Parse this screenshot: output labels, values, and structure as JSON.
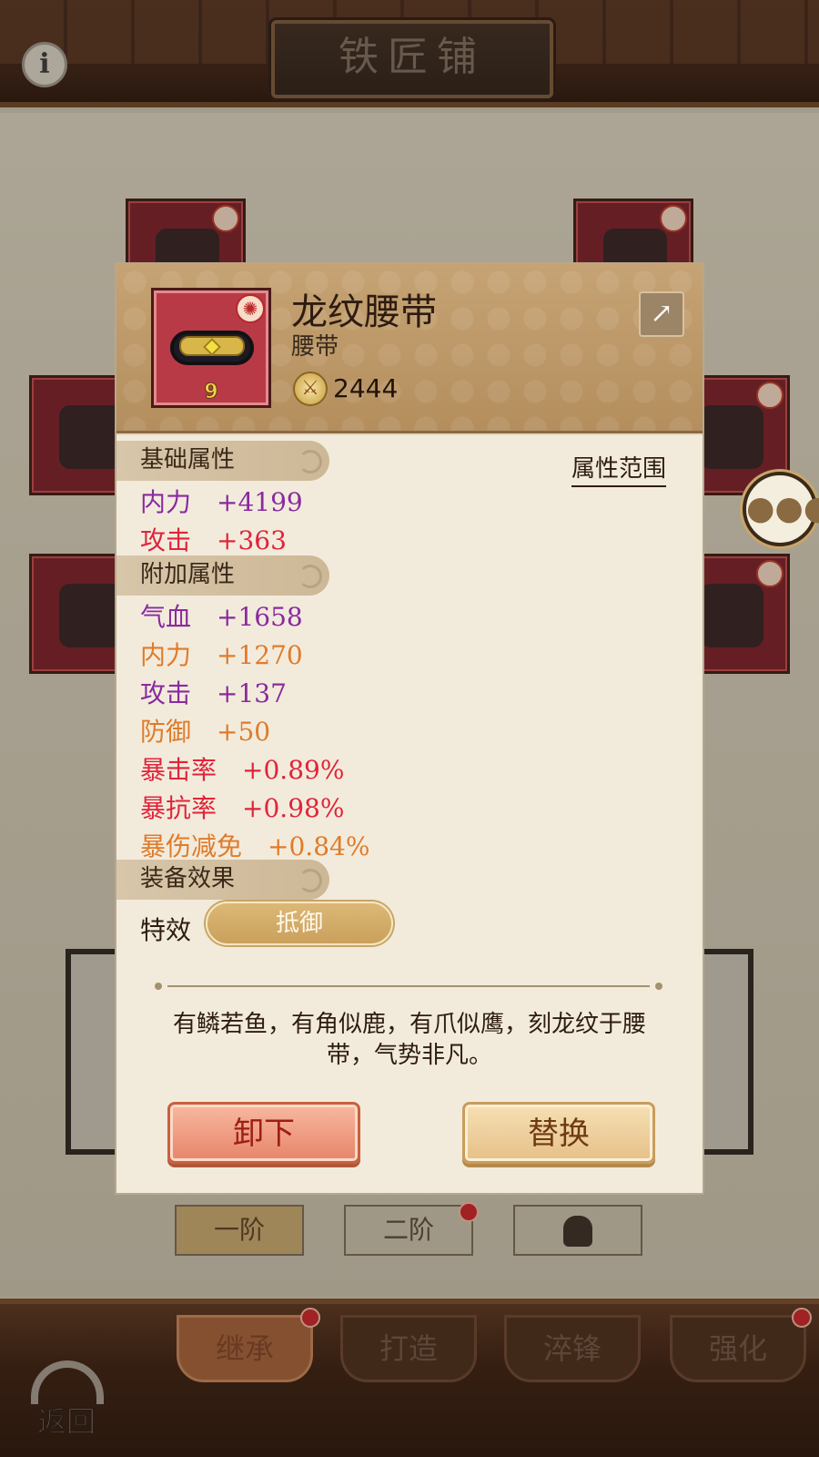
{
  "screen": {
    "title": "铁匠铺",
    "info_icon": "i",
    "tiers": [
      "一阶",
      "二阶"
    ],
    "bottom_tabs": [
      "继承",
      "打造",
      "淬锋",
      "强化"
    ],
    "back_label": "返回"
  },
  "item": {
    "name": "龙纹腰带",
    "type": "腰带",
    "level": "9",
    "power": "2444"
  },
  "range_link": "属性范围",
  "sections": {
    "base": "基础属性",
    "extra": "附加属性",
    "effect": "装备效果"
  },
  "base_stats": [
    {
      "name": "内力",
      "value": "+4199",
      "color": "#8a2a9e"
    },
    {
      "name": "攻击",
      "value": "+363",
      "color": "#e0243a"
    }
  ],
  "extra_stats": [
    {
      "name": "气血",
      "value": "+1658",
      "color": "#8a2a9e"
    },
    {
      "name": "内力",
      "value": "+1270",
      "color": "#e07b2a"
    },
    {
      "name": "攻击",
      "value": "+137",
      "color": "#8a2a9e"
    },
    {
      "name": "防御",
      "value": "+50",
      "color": "#e07b2a"
    },
    {
      "name": "暴击率",
      "value": "+0.89%",
      "color": "#e0243a"
    },
    {
      "name": "暴抗率",
      "value": "+0.98%",
      "color": "#e0243a"
    },
    {
      "name": "暴伤减免",
      "value": "+0.84%",
      "color": "#e07b2a"
    }
  ],
  "effect": {
    "label": "特效",
    "value": "抵御"
  },
  "description": "有鳞若鱼，有角似鹿，有爪似鹰，刻龙纹于腰带，气势非凡。",
  "buttons": {
    "unequip": "卸下",
    "replace": "替换"
  },
  "colors": {
    "purple": "#8a2a9e",
    "red": "#e0243a",
    "orange": "#e07b2a",
    "header_gold": "#c6a374"
  },
  "icons": [
    "info-icon",
    "share-icon",
    "chat-icon",
    "lock-icon",
    "power-icon",
    "back-arrow-icon"
  ]
}
